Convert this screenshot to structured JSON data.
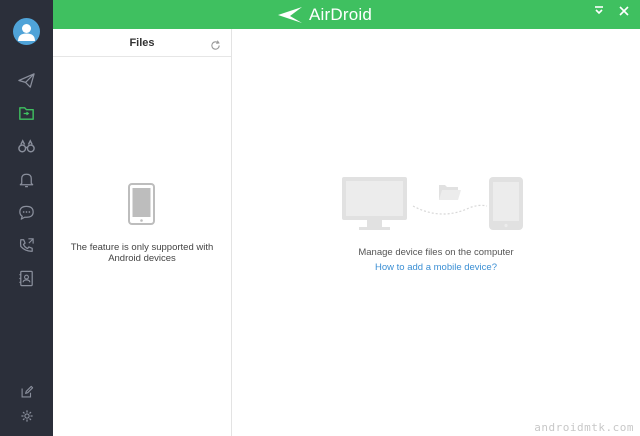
{
  "app": {
    "title": "AirDroid"
  },
  "colors": {
    "accent": "#3fc060",
    "sidebar_bg": "#2b2f3a",
    "link": "#3b8fd4",
    "active_icon": "#3fc060"
  },
  "sidebar": {
    "items": [
      {
        "name": "transfer",
        "icon": "paper-plane-icon"
      },
      {
        "name": "files",
        "icon": "folder-icon",
        "active": true
      },
      {
        "name": "find-phone",
        "icon": "binoculars-icon"
      },
      {
        "name": "notifications",
        "icon": "bell-icon"
      },
      {
        "name": "messages",
        "icon": "chat-bubble-icon"
      },
      {
        "name": "calls",
        "icon": "phone-call-icon"
      },
      {
        "name": "contacts",
        "icon": "contacts-icon"
      }
    ],
    "bottom": [
      {
        "name": "edit",
        "icon": "edit-icon"
      },
      {
        "name": "settings",
        "icon": "gear-icon"
      }
    ]
  },
  "files_panel": {
    "title": "Files",
    "unsupported_line1": "The feature is only supported with",
    "unsupported_line2": "Android devices"
  },
  "main": {
    "manage_text": "Manage device files on the computer",
    "help_link": "How to add a mobile device?"
  },
  "watermark": "androidmtk.com"
}
